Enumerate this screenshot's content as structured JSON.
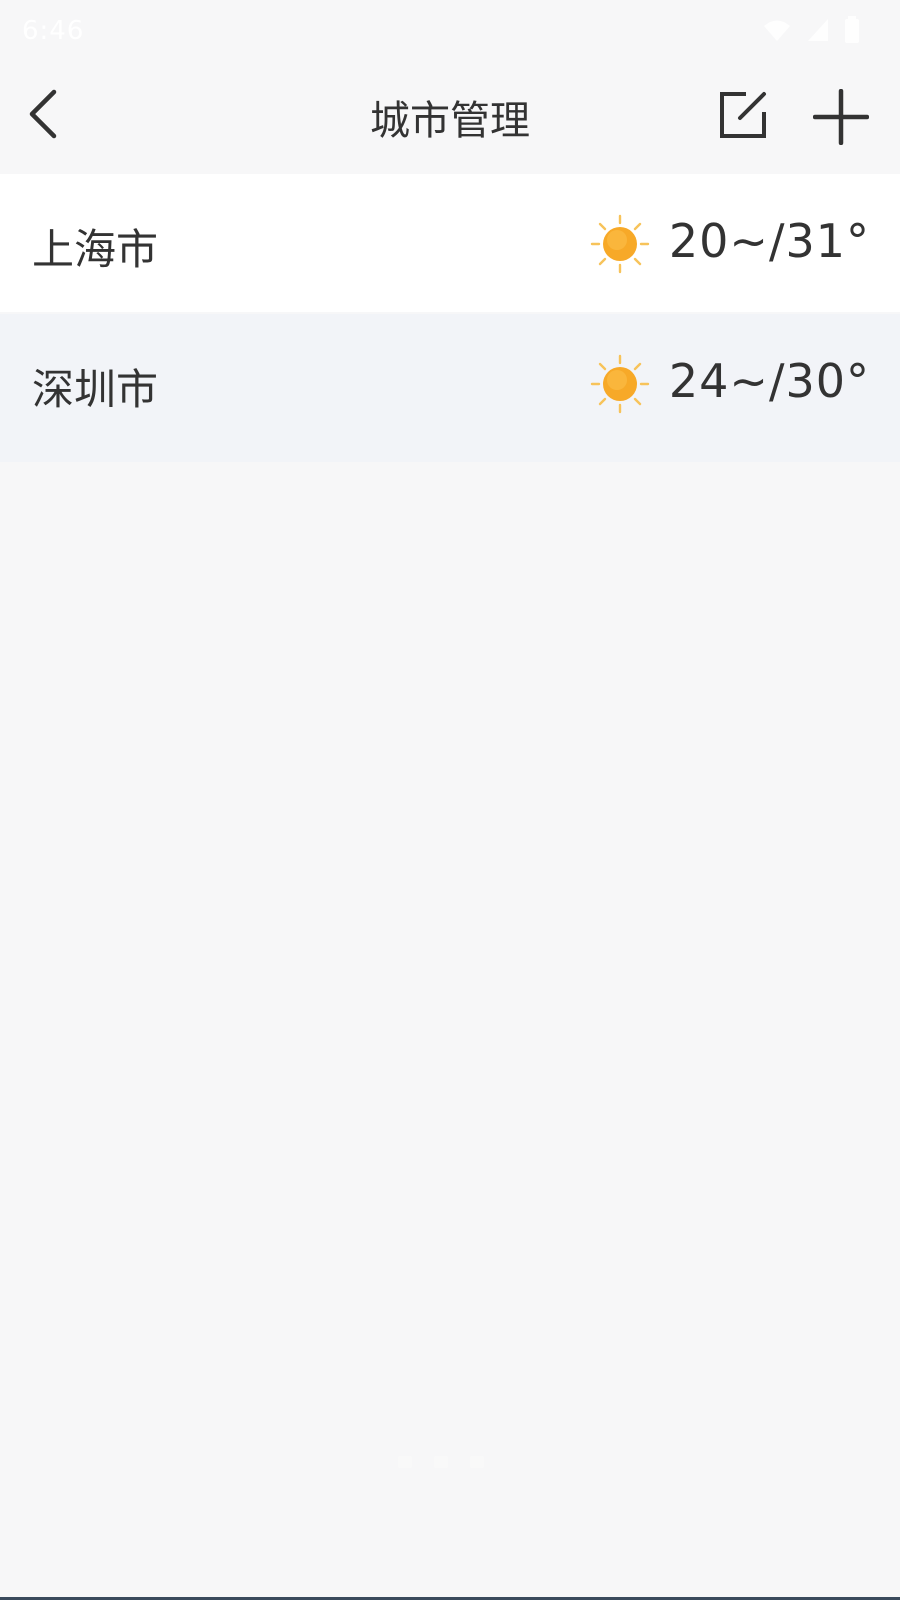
{
  "status_bar": {
    "time": "6:46",
    "icons": [
      "wifi-icon",
      "signal-icon",
      "battery-icon"
    ]
  },
  "header": {
    "title": "城市管理",
    "back_icon": "chevron-left-icon",
    "edit_icon": "edit-icon",
    "add_icon": "plus-icon"
  },
  "cities": [
    {
      "name": "上海市",
      "weather_icon": "sun-icon",
      "temp": "20~/31°"
    },
    {
      "name": "深圳市",
      "weather_icon": "sun-icon",
      "temp": "24~/30°"
    }
  ],
  "colors": {
    "background": "#f7f7f8",
    "row_white": "#ffffff",
    "row_highlight": "#f2f4f8",
    "sun": "#f7a928"
  }
}
